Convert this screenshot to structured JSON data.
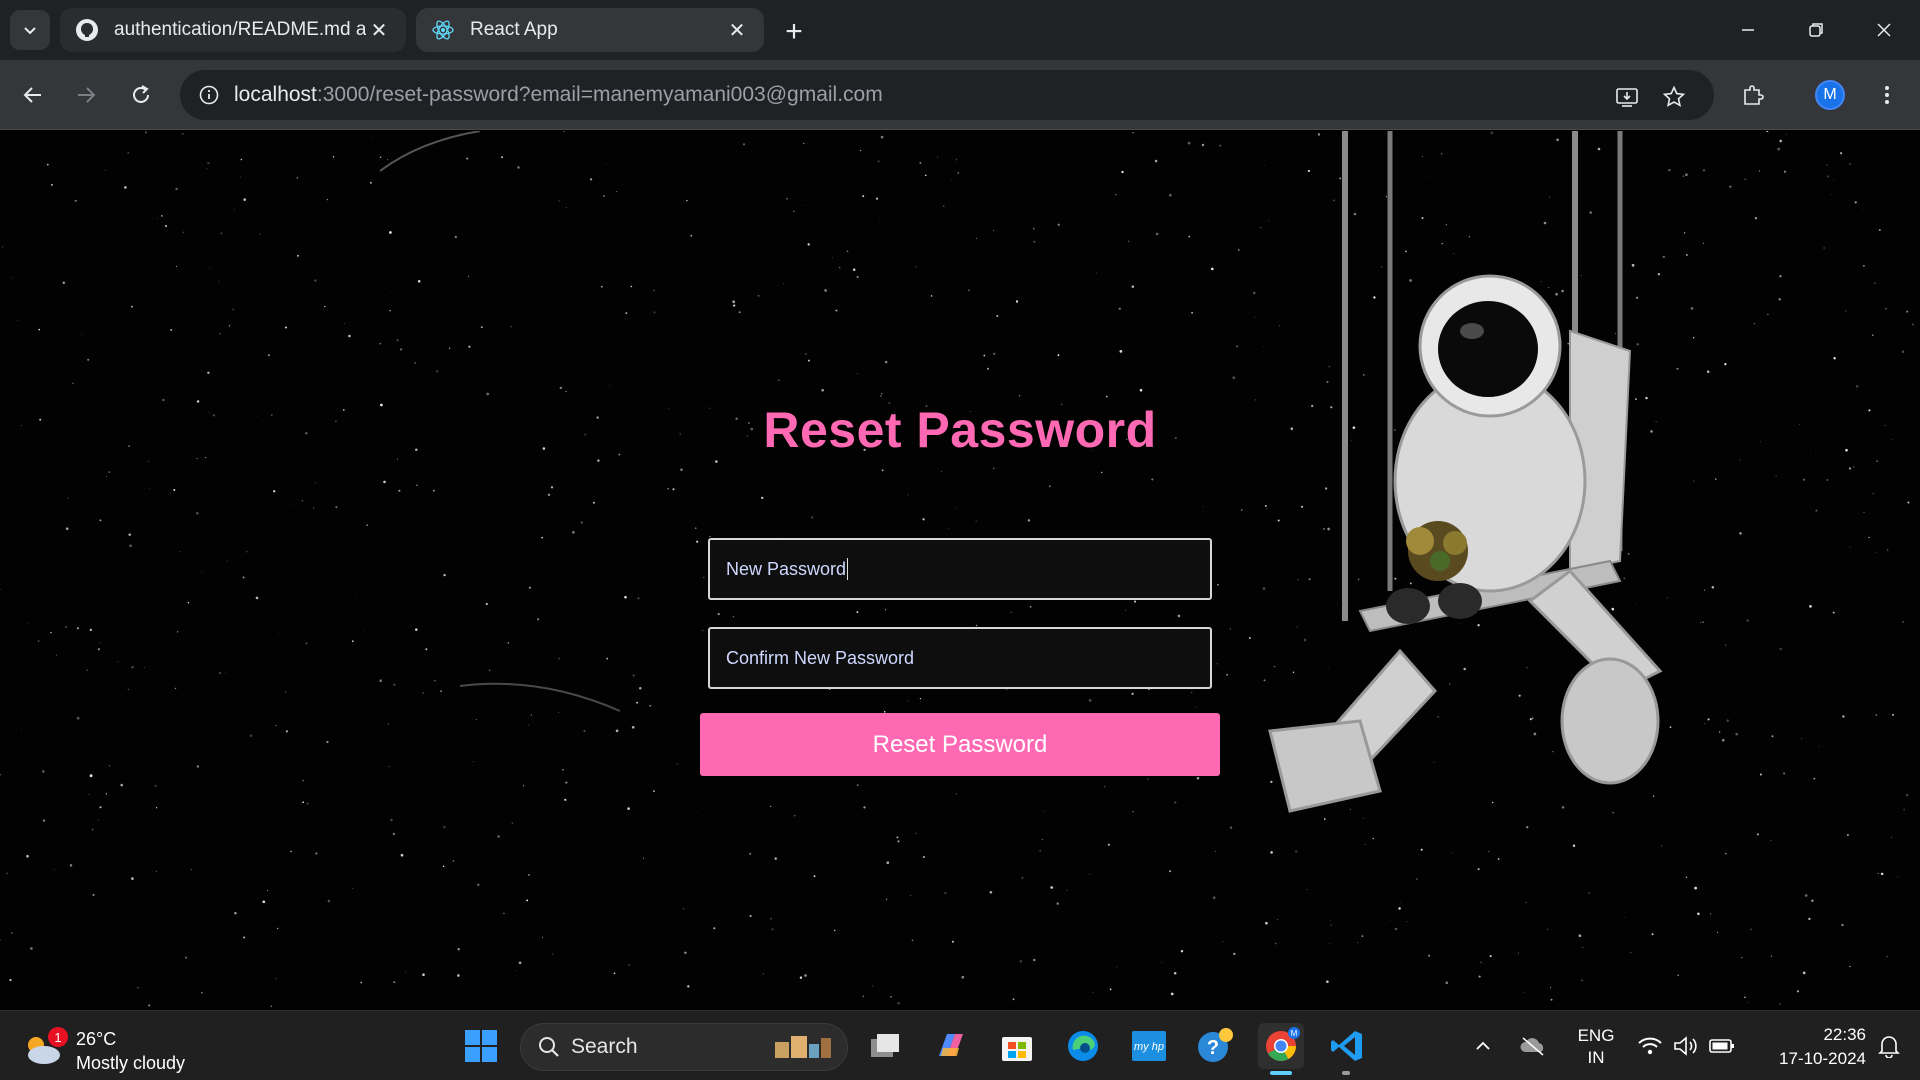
{
  "browser": {
    "tabs": [
      {
        "title": "authentication/README.md at m",
        "favicon": "github-icon",
        "active": false
      },
      {
        "title": "React App",
        "favicon": "react-icon",
        "active": true
      }
    ],
    "url_host": "localhost",
    "url_rest": ":3000/reset-password?email=manemyamani003@gmail.com",
    "profile_initial": "M"
  },
  "form": {
    "title": "Reset Password",
    "new_password_placeholder": "New Password",
    "confirm_password_placeholder": "Confirm New Password",
    "submit_label": "Reset Password"
  },
  "taskbar": {
    "weather_temp": "26°C",
    "weather_condition": "Mostly cloudy",
    "weather_badge": "1",
    "search_label": "Search",
    "language": "ENG",
    "region": "IN",
    "time": "22:36",
    "date": "17-10-2024"
  },
  "colors": {
    "accent_pink": "#ff69b4",
    "chrome_dark": "#202124",
    "chrome_toolbar": "#35363a"
  }
}
